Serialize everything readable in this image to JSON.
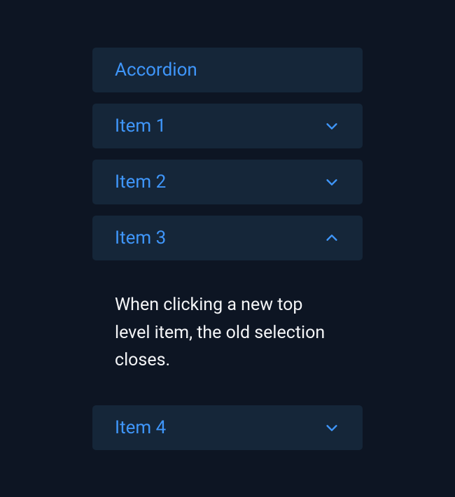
{
  "header": "Accordion",
  "items": [
    {
      "label": "Item 1",
      "expanded": false
    },
    {
      "label": "Item 2",
      "expanded": false
    },
    {
      "label": "Item 3",
      "expanded": true
    },
    {
      "label": "Item 4",
      "expanded": false
    }
  ],
  "content": "When clicking a new top level item, the old selection closes."
}
